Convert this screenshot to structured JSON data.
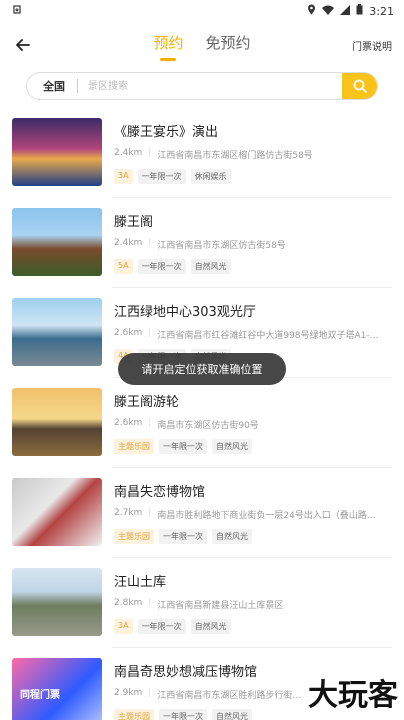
{
  "statusbar": {
    "time": "3:21"
  },
  "header": {
    "tabs": [
      {
        "label": "预约"
      },
      {
        "label": "免预约"
      }
    ],
    "notice_label": "门票说明"
  },
  "search": {
    "city": "全国",
    "placeholder": "景区搜索"
  },
  "items": [
    {
      "name": "《滕王宴乐》演出",
      "distance": "2.4km",
      "address": "江西省南昌市东湖区榕门路仿古街58号",
      "tags": [
        "3A",
        "一年限一次",
        "休闲娱乐"
      ]
    },
    {
      "name": "滕王阁",
      "distance": "2.4km",
      "address": "江西省南昌市东湖区仿古街58号",
      "tags": [
        "5A",
        "一年限一次",
        "自然风光"
      ]
    },
    {
      "name": "江西绿地中心303观光厅",
      "distance": "2.6km",
      "address": "江西省南昌市红谷滩红谷中大道998号绿地双子塔A1-…",
      "tags": [
        "4A",
        "一年限一次",
        "自然风光"
      ]
    },
    {
      "name": "滕王阁游轮",
      "distance": "2.6km",
      "address": "南昌市东湖区仿古街90号",
      "tags": [
        "主题乐园",
        "一年限一次",
        "自然风光"
      ]
    },
    {
      "name": "南昌失恋博物馆",
      "distance": "2.7km",
      "address": "南昌市胜利路地下商业街负一层24号出入口（叠山路…",
      "tags": [
        "主题乐园",
        "一年限一次",
        "自然风光"
      ]
    },
    {
      "name": "汪山土库",
      "distance": "2.8km",
      "address": "江西省南昌新建县汪山土库景区",
      "tags": [
        "3A",
        "一年限一次",
        "自然风光"
      ]
    },
    {
      "name": "南昌奇思妙想减压博物馆",
      "distance": "2.9km",
      "address": "江西省南昌市东湖区胜利路步行街…",
      "tags": [
        "主题乐园",
        "一年限一次",
        "自然风光"
      ]
    }
  ],
  "toast": "请开启定位获取准确位置",
  "thumb7_text": "同程门票",
  "watermark": "大玩客"
}
